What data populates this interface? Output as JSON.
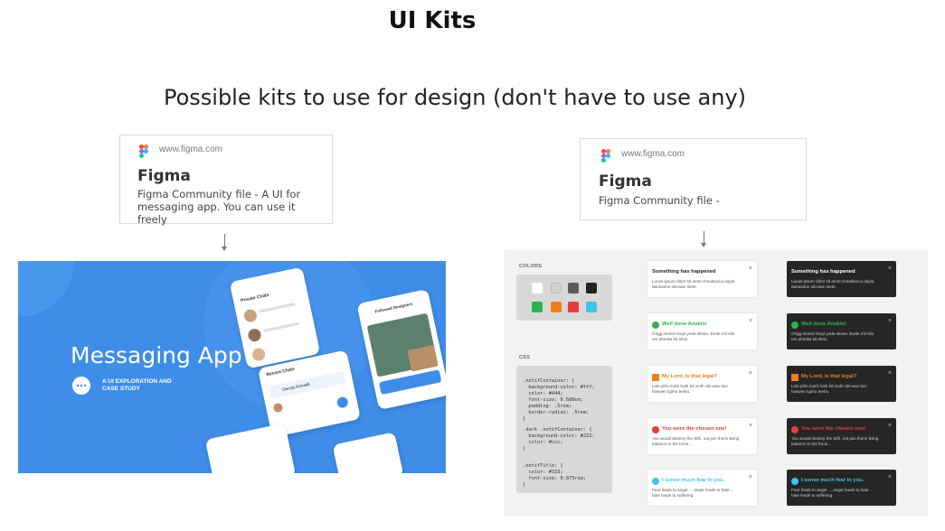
{
  "page": {
    "title": "UI Kits",
    "subtitle": "Possible kits to use for design (don't have to use any)"
  },
  "cards": [
    {
      "url": "www.figma.com",
      "title": "Figma",
      "description": "Figma Community file - A UI for messaging app. You can use it freely",
      "icon": "figma-logo-icon"
    },
    {
      "url": "www.figma.com",
      "title": "Figma",
      "description": "Figma Community file -",
      "icon": "figma-logo-icon"
    }
  ],
  "messaging_preview": {
    "title": "Messaging App",
    "subtitle": "A UI EXPLORATION AND CASE STUDY",
    "accent": "#3f8de9",
    "screens": {
      "chats_header": "Private Chats",
      "friends_header": "Recent Chats",
      "profile_header": "Followed Designers",
      "contact_name": "Dennis Ronaldi"
    }
  },
  "kit_preview": {
    "colors_label": "COLORS",
    "css_label": "CSS",
    "swatches": [
      "#ffffff",
      "#d0d0d0",
      "#5c5c5c",
      "#222222",
      "#2fb24c",
      "#f07d1a",
      "#e93d3d",
      "#3dc5e8"
    ],
    "code_lines": [
      ".notifContainer: {",
      "  background-color: #fff;",
      "  color: #444;",
      "  font-size: 0.688em;",
      "  padding: .5rem;",
      "  border-radius: .5rem;",
      "}",
      "",
      ".dark .notifContainer: {",
      "  background-color: #222;",
      "  color: #ccc;",
      "}",
      "",
      ".notifTitle: {",
      "  color: #333;",
      "  font-size: 0.875rem;",
      "}"
    ],
    "notifications": [
      {
        "title": "Something has happened",
        "body": "Lucas ipsum dolor sit amet chewbacca dayla dantooine obi-wan stele.",
        "icon": "",
        "color": "#222222",
        "dark_title_color": "#ffffff"
      },
      {
        "title": "Well done Anakin!",
        "body": "Grigg elomin krayt yoda skosa. Ewok mil nilo rex ahsoka kit shmi.",
        "icon": "check-circle-icon",
        "color": "#2fb24c",
        "dark_title_color": "#2fb24c"
      },
      {
        "title": "My Lord, is that legal?",
        "body": "Lola phlo moth hoth kit moth obi-wan tion hoswen typho teebo.",
        "icon": "warning-icon",
        "color": "#f07d1a",
        "dark_title_color": "#f07d1a"
      },
      {
        "title": "You were the chosen one!",
        "body": "You would destroy the Sith, not join them! Bring balance to the force...",
        "icon": "error-circle-icon",
        "color": "#e93d3d",
        "dark_title_color": "#e93d3d"
      },
      {
        "title": "I sense much fear in you.",
        "body": "Fear leads to anger ... anger leads to hate ... hate leads to suffering.",
        "icon": "info-circle-icon",
        "color": "#3dc5e8",
        "dark_title_color": "#3dc5e8"
      }
    ],
    "close_glyph": "×"
  }
}
